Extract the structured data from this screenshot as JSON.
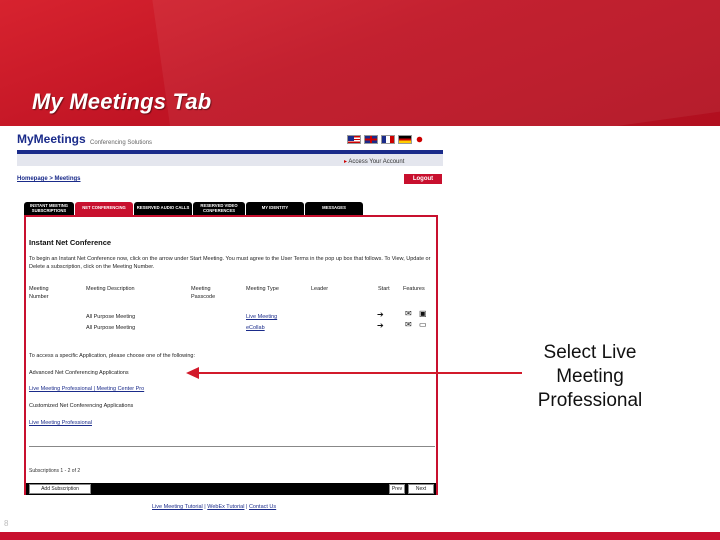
{
  "slide": {
    "title": "My Meetings Tab",
    "number": "8",
    "callout": "Select Live Meeting Professional"
  },
  "app": {
    "brand": "MyMeetings",
    "brand_sub": "Conferencing Solutions",
    "access_account": "Access Your Account",
    "breadcrumb": "Homepage > Meetings",
    "logout": "Logout",
    "tabs": [
      {
        "label": "INSTANT MEETING SUBSCRIPTIONS",
        "active": false
      },
      {
        "label": "NET CONFERENCING",
        "active": true
      },
      {
        "label": "RESERVED AUDIO CALLS",
        "active": false
      },
      {
        "label": "RESERVED VIDEO CONFERENCES",
        "active": false
      },
      {
        "label": "MY IDENTITY",
        "active": false
      },
      {
        "label": "MESSAGES",
        "active": false
      }
    ],
    "panel_title": "Instant Net Conference",
    "instructions": "To begin an Instant Net Conference now, click on the arrow under Start Meeting. You must agree to the User Terms in the pop up box that follows. To View, Update or Delete a subscription, click on the Meeting Number.",
    "columns": [
      "Meeting Number",
      "Meeting Description",
      "Meeting Passcode",
      "Meeting Type",
      "Leader",
      "Start",
      "Features"
    ],
    "rows": [
      {
        "description": "All Purpose Meeting",
        "type": "Live Meeting"
      },
      {
        "description": "All Purpose Meeting",
        "type": "eCollab"
      }
    ],
    "access_prompt": "To access a specific Application, please choose one of the following:",
    "advanced_heading": "Advanced Net Conferencing Applications",
    "advanced_links": [
      "Live Meeting Professional",
      "Meeting Center Pro"
    ],
    "custom_heading": "Customized Net Conferencing Applications",
    "custom_links": [
      "Live Meeting Professional"
    ],
    "subs_count": "Subscriptions 1 - 2 of 2",
    "buttons": {
      "add": "Add Subscription",
      "prev": "Prev",
      "next": "Next"
    },
    "footer": [
      "Live Meeting Tutorial",
      "WebEx Tutorial",
      "Contact Us"
    ]
  }
}
